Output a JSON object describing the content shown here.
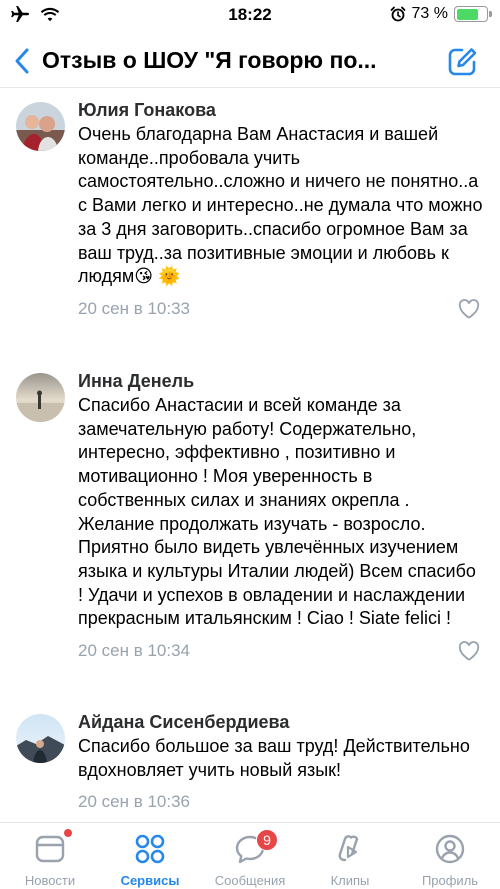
{
  "status_bar": {
    "time": "18:22",
    "battery_text": "73 %",
    "battery_level": 0.73,
    "battery_color": "#4cd964"
  },
  "header": {
    "title": "Отзыв о ШОУ \"Я говорю по...",
    "back_icon": "chevron-left-icon",
    "edit_icon": "compose-icon",
    "accent_color": "#2688eb"
  },
  "comments": [
    {
      "author": "Юлия Гонакова",
      "text": "Очень благодарна Вам Анастасия и вашей команде..пробовала  учить самостоятельно..сложно и ничего не понятно..а с Вами легко  и интересно..не думала что можно за 3 дня заговорить..спасибо огромное Вам за ваш труд..за позитивные эмоции и любовь к людям😘 🌞",
      "date": "20 сен в 10:33"
    },
    {
      "author": "Инна Денель",
      "text": "Спасибо Анастасии и всей команде за замечательную работу! Содержательно, интересно, эффективно , позитивно и мотивационно ! Моя уверенность в собственных силах и знаниях окрепла . Желание продолжать изучать - возросло. Приятно было видеть  увлечённых изучением языка и культуры Италии людей) Всем спасибо ! Удачи и успехов в овладении и наслаждении прекрасным итальянским ! Ciao ! Siate felici !",
      "date": "20 сен в 10:34"
    },
    {
      "author": "Айдана Сисенбердиева",
      "text": "Спасибо большое за ваш труд! Действительно вдохновляет учить новый язык!",
      "date": "20 сен в 10:36"
    }
  ],
  "tabbar": {
    "tabs": [
      {
        "label": "Новости",
        "icon": "news-icon"
      },
      {
        "label": "Сервисы",
        "icon": "services-icon"
      },
      {
        "label": "Сообщения",
        "icon": "messages-icon",
        "badge": "9"
      },
      {
        "label": "Клипы",
        "icon": "clips-icon"
      },
      {
        "label": "Профиль",
        "icon": "profile-icon"
      }
    ]
  }
}
